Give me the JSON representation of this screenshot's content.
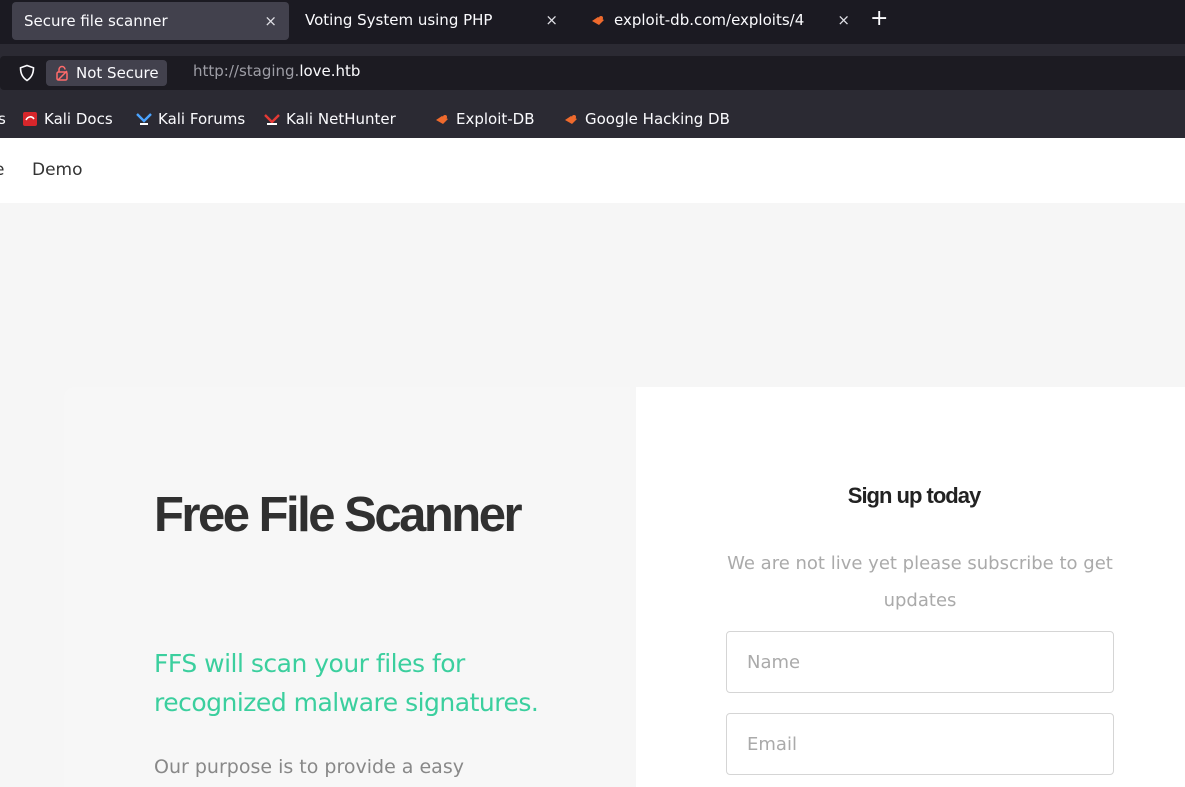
{
  "tabs": [
    {
      "title": "Secure file scanner",
      "close": "×",
      "active": true
    },
    {
      "title": "Voting System using PHP",
      "close": "×",
      "active": false
    },
    {
      "title": "exploit-db.com/exploits/4",
      "close": "×",
      "active": false,
      "icon": "exploit-db-icon"
    }
  ],
  "new_tab": "+",
  "urlbar": {
    "security_label": "Not Secure",
    "url_prefix": "http://staging.",
    "url_host": "love.htb"
  },
  "bookmarks": {
    "truncated": "s",
    "items": [
      {
        "label": "Kali Docs",
        "icon": "kali-docs-icon"
      },
      {
        "label": "Kali Forums",
        "icon": "kali-forums-icon"
      },
      {
        "label": "Kali NetHunter",
        "icon": "kali-nethunter-icon"
      },
      {
        "label": "Exploit-DB",
        "icon": "exploit-db-icon"
      },
      {
        "label": "Google Hacking DB",
        "icon": "exploit-db-icon"
      }
    ]
  },
  "site_nav": {
    "truncated": "e",
    "demo": "Demo"
  },
  "hero": {
    "title": "Free File Scanner",
    "subtitle": "FFS will scan your files for recognized malware signatures.",
    "body": "Our purpose is to provide a easy"
  },
  "signup": {
    "title": "Sign up today",
    "description": "We are not live yet please subscribe to get updates",
    "name_placeholder": "Name",
    "email_placeholder": "Email"
  },
  "colors": {
    "accent": "#3bcf9e",
    "tabbar_bg": "#1b1a22",
    "toolbar_bg": "#2b2a33"
  }
}
